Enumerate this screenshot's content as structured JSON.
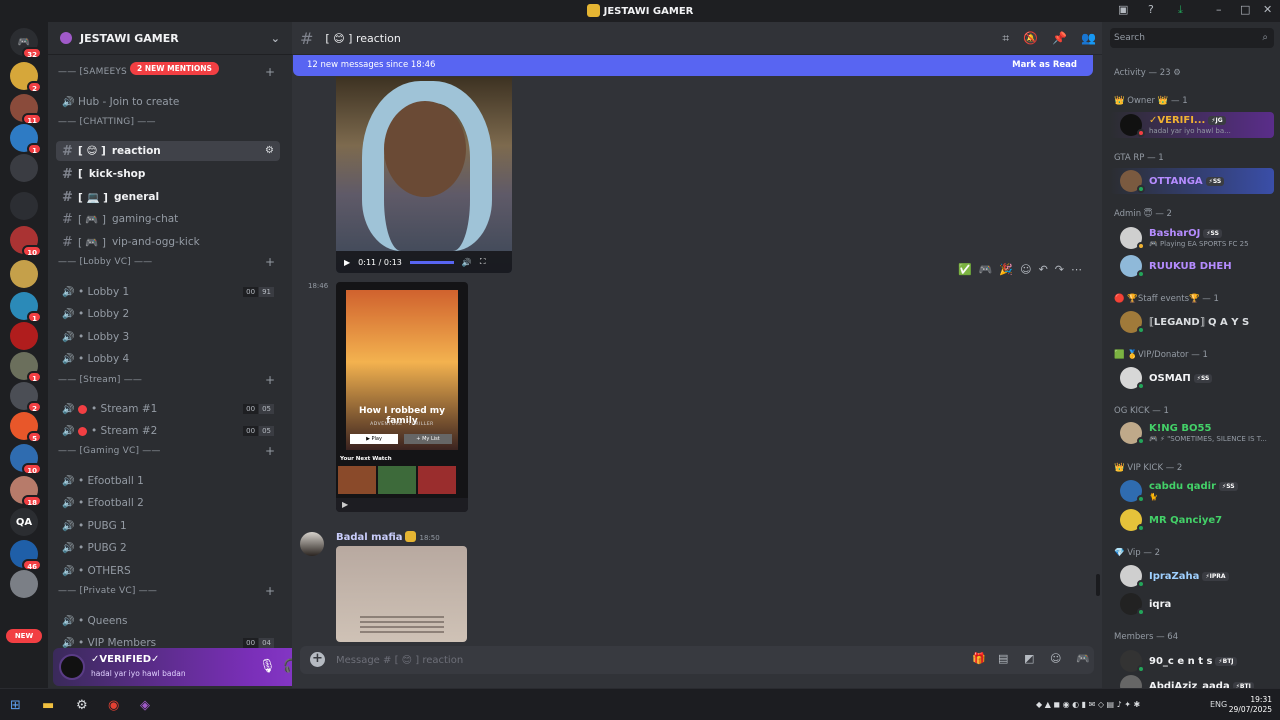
{
  "app": {
    "title": "JESTAWI GAMER"
  },
  "rail": {
    "home_badge": "32",
    "servers": [
      {
        "badge": "2",
        "color": "#d6a73a"
      },
      {
        "badge": "11",
        "color": "#8a4b3b"
      },
      {
        "badge": "1",
        "color": "#2e7bc4"
      },
      {
        "badge": "",
        "color": "#3a3c42"
      },
      {
        "badge": "",
        "color": "#2c2e33"
      },
      {
        "badge": "10",
        "color": "#a33"
      },
      {
        "badge": "",
        "color": "#c5a04a"
      },
      {
        "badge": "1",
        "color": "#2b8ab8"
      },
      {
        "badge": "",
        "color": "#b01d1d"
      },
      {
        "badge": "1",
        "color": "#6b6f5c"
      },
      {
        "badge": "2",
        "color": "#4b4e55"
      },
      {
        "badge": "5",
        "color": "#e8572a"
      },
      {
        "badge": "10",
        "color": "#2f6cb0"
      },
      {
        "badge": "18",
        "color": "#b77b6a"
      },
      {
        "badge": "",
        "color": "#2b2d31",
        "label": "QA"
      },
      {
        "badge": "46",
        "color": "#1f5fa8"
      },
      {
        "badge": "",
        "color": "#7b7f86"
      }
    ],
    "new_label": "NEW"
  },
  "guild": {
    "name": "JESTAWI GAMER",
    "mentions": "2 NEW MENTIONS",
    "categories": [
      {
        "label": "—— [SAMEEYS",
        "channels": [
          {
            "name": "Hub - Join to create",
            "type": "voice"
          }
        ]
      },
      {
        "label": "—— [CHATTING] ——",
        "channels": [
          {
            "name": "reaction",
            "prefix": "[ 😊 ]",
            "type": "text",
            "state": "active"
          },
          {
            "name": "kick-shop",
            "prefix": "[",
            "type": "text",
            "state": "bold"
          },
          {
            "name": "general",
            "prefix": "[ 💻 ]",
            "type": "text",
            "state": "bold"
          },
          {
            "name": "gaming-chat",
            "prefix": "[ 🎮 ]",
            "type": "text",
            "state": "muted"
          },
          {
            "name": "vip-and-ogg-kick",
            "prefix": "[ 🎮 ]",
            "type": "text",
            "state": "muted"
          }
        ]
      },
      {
        "label": "—— [Lobby VC] ——",
        "channels": [
          {
            "name": "• Lobby 1",
            "type": "voice",
            "vc": [
              "00",
              "91"
            ]
          },
          {
            "name": "• Lobby 2",
            "type": "voice"
          },
          {
            "name": "• Lobby 3",
            "type": "voice"
          },
          {
            "name": "• Lobby 4",
            "type": "voice"
          }
        ]
      },
      {
        "label": "—— [Stream] ——",
        "channels": [
          {
            "name": "• Stream #1",
            "type": "voice",
            "red": true,
            "vc": [
              "00",
              "05"
            ]
          },
          {
            "name": "• Stream #2",
            "type": "voice",
            "red": true,
            "vc": [
              "00",
              "05"
            ]
          }
        ]
      },
      {
        "label": "—— [Gaming VC] ——",
        "channels": [
          {
            "name": "• Efootball 1",
            "type": "voice"
          },
          {
            "name": "• Efootball 2",
            "type": "voice"
          },
          {
            "name": "• PUBG 1",
            "type": "voice"
          },
          {
            "name": "• PUBG 2",
            "type": "voice"
          },
          {
            "name": "• OTHERS",
            "type": "voice"
          }
        ]
      },
      {
        "label": "—— [Private VC] ——",
        "channels": [
          {
            "name": "• Queens",
            "type": "voice"
          },
          {
            "name": "• VIP Members",
            "type": "voice",
            "vc": [
              "00",
              "04"
            ]
          }
        ]
      }
    ]
  },
  "user": {
    "name": "✓VERIFIED✓",
    "status": "hadal yar iyo hawl badan"
  },
  "channel": {
    "title": "[ 😊 ] reaction",
    "new_messages": "12 new messages since 18:46",
    "mark_read": "Mark as Read",
    "video_time": "0:11 / 0:13",
    "timestamp1": "18:46",
    "card": {
      "title": "How I robbed my family",
      "subtitle": "ADVENTURE · THRILLER",
      "play": "▶ Play",
      "mylist": "+ My List",
      "next": "Your Next Watch"
    },
    "author": "Badal mafia",
    "author_time": "18:50",
    "composer_placeholder": "Message # [ 😊 ] reaction"
  },
  "members": {
    "search_placeholder": "Search",
    "activity": "Activity — 23 ⚙",
    "groups": [
      {
        "label": "👑 Owner 👑 — 1",
        "items": [
          {
            "name": "✓VERIFI...",
            "tag": "⚡JG",
            "status": "hadal yar iyo hawl ba...",
            "color": "#f0b232",
            "av": "#111"
          }
        ]
      },
      {
        "label": "GTA RP — 1",
        "items": [
          {
            "name": "OTTANGA",
            "tag": "⚡SS",
            "status": "",
            "color": "#b58cff",
            "av": "#7a5a40"
          }
        ]
      },
      {
        "label": "Admin 😇 — 2",
        "items": [
          {
            "name": "BasharOJ",
            "tag": "⚡SS",
            "status": "🎮 Playing EA SPORTS FC 25",
            "color": "#b58cff",
            "av": "#cfcfcf"
          },
          {
            "name": "RUUKUB DHEH",
            "tag": "",
            "status": "",
            "color": "#b58cff",
            "av": "#8fb9d9"
          }
        ]
      },
      {
        "label": "🔴 🏆Staff events🏆 — 1",
        "items": [
          {
            "name": "⟦LEGAND⟧ Q A Y S",
            "tag": "",
            "status": "",
            "color": "#dbdee1",
            "av": "#a07a3a"
          }
        ]
      },
      {
        "label": "🟩 🥇VIP/Donator — 1",
        "items": [
          {
            "name": "OSMAΠ",
            "tag": "⚡SS",
            "status": "",
            "color": "#f2f3f5",
            "av": "#d7d7d7"
          }
        ]
      },
      {
        "label": "OG KICK — 1",
        "items": [
          {
            "name": "K!NG BO55",
            "tag": "",
            "status": "🎮 ⚡ \"SOMETIMES, SILENCE IS T...",
            "color": "#43d168",
            "av": "#bfa98a"
          }
        ]
      },
      {
        "label": "👑 VIP KICK — 2",
        "items": [
          {
            "name": "cabdu qadir",
            "tag": "⚡SS",
            "status": "🐈",
            "color": "#43d168",
            "av": "#2f6cb0"
          },
          {
            "name": "MR Qanciye7",
            "tag": "",
            "status": "",
            "color": "#43d168",
            "av": "#e5c23a"
          }
        ]
      },
      {
        "label": "💎 Vip — 2",
        "items": [
          {
            "name": "IpraZaha",
            "tag": "⚡IPRA",
            "status": "",
            "color": "#9fd0ff",
            "av": "#cfcfcf"
          },
          {
            "name": "iqra",
            "tag": "",
            "status": "",
            "color": "#f2f3f5",
            "av": "#222"
          }
        ]
      },
      {
        "label": "Members — 64",
        "items": [
          {
            "name": "90_c e n t s",
            "tag": "⚡BTJ",
            "status": "",
            "color": "#f2f3f5",
            "av": "#333"
          },
          {
            "name": "AbdiAziz_aada",
            "tag": "⚡BTJ",
            "status": "",
            "color": "#f2f3f5",
            "av": "#666"
          }
        ]
      }
    ]
  },
  "taskbar": {
    "lang": "ENG",
    "time": "19:31",
    "date": "29/07/2025"
  },
  "colors": {
    "accent": "#5865f2",
    "danger": "#f23f43",
    "online": "#23a55a"
  }
}
